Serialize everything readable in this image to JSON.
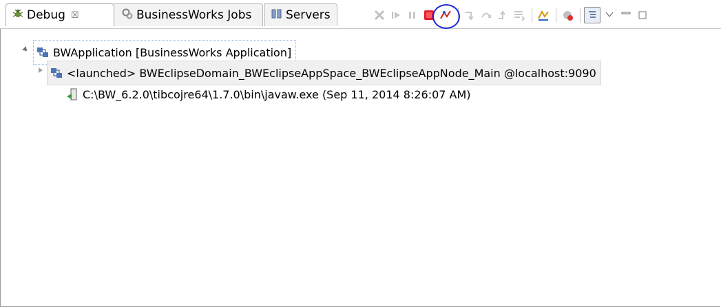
{
  "tabs": [
    {
      "label": "Debug",
      "close": "☒"
    },
    {
      "label": "BusinessWorks Jobs"
    },
    {
      "label": "Servers"
    }
  ],
  "toolbar": {
    "icons": [
      "remove-terminated-icon",
      "resume-icon",
      "suspend-icon",
      "terminate-icon",
      "disconnect-icon",
      "step-into-icon",
      "step-over-icon",
      "step-return-icon",
      "drop-to-frame-icon",
      "use-step-filters-icon",
      "skip-breakpoints-icon",
      "show-system-threads-icon",
      "view-menu-icon",
      "minimize-icon",
      "maximize-icon"
    ],
    "highlight_color": "#1a28d8",
    "terminate_color": "#e0202a"
  },
  "tree": {
    "app": "BWApplication [BusinessWorks Application]",
    "launched": "<launched> BWEclipseDomain_BWEclipseAppSpace_BWEclipseAppNode_Main @localhost:9090",
    "process": "C:\\BW_6.2.0\\tibcojre64\\1.7.0\\bin\\javaw.exe (Sep 11, 2014 8:26:07 AM)"
  }
}
